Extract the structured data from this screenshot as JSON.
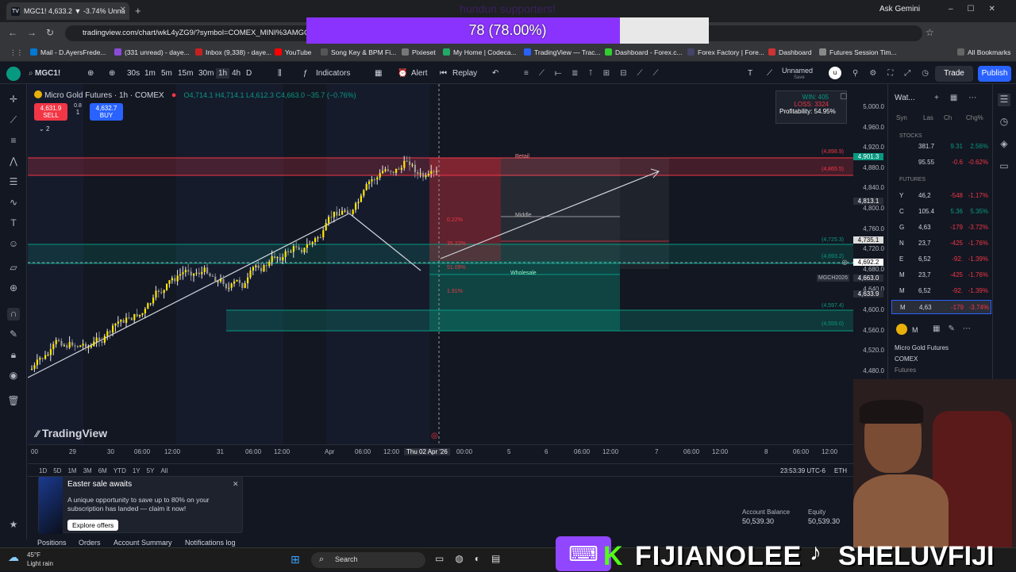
{
  "browser": {
    "tab_title": "MGC1! 4,633.2 ▼ -3.74% Unna",
    "ask_gemini": "Ask Gemini",
    "url": "tradingview.com/chart/wkL4yZG9/?symbol=COMEX_MINI%3AMGC1!",
    "bookmarks": [
      "Mail - D.AyersFrede...",
      "(331 unread) - daye...",
      "Inbox (9,338) - daye...",
      "YouTube",
      "Song Key & BPM Fi...",
      "Pixieset",
      "My Home | Codeca...",
      "TradingView — Trac...",
      "Dashboard - Forex.c...",
      "Forex Factory | Fore...",
      "Dashboard",
      "Futures Session Tim...",
      "All Bookmarks"
    ]
  },
  "poll": {
    "title": "hundun supporters!",
    "result": "78 (78.00%)",
    "percent": 78
  },
  "toolbar": {
    "symbol": "MGC1!",
    "intervals": [
      "30s",
      "1m",
      "5m",
      "15m",
      "30m",
      "1h",
      "4h",
      "D"
    ],
    "active_interval": "1h",
    "indicators": "Indicators",
    "alert": "Alert",
    "replay": "Replay",
    "layout_name": "Unnamed",
    "layout_sub": "Save",
    "trade": "Trade",
    "publish": "Publish"
  },
  "legend": {
    "title": "Micro Gold Futures · 1h · COMEX",
    "ohlc": "O4,714.1 H4,714.1 L4,612.3 C4,663.0 −35.7 (−0.76%)",
    "sell_price": "4,631.9",
    "sell_label": "SELL",
    "qty": "1",
    "qty_top": "0.8",
    "buy_price": "4,632.7",
    "buy_label": "BUY",
    "indicator_count": "2"
  },
  "stats": {
    "win": "WIN: 405",
    "loss": "LOSS: 3324",
    "profitability": "Profitability: 54.95%"
  },
  "chart_labels": {
    "retail": "Retail",
    "middle": "Middle",
    "wholesale": "Wholesale",
    "pct1": "0.22%",
    "pct2": "35.22%",
    "pct3": "51.09%",
    "pct4": "1.91%",
    "lvl1": "(4,898.9)",
    "lvl2": "(4,865.5)",
    "lvl3": "(4,725.3)",
    "lvl4": "(4,693.2)",
    "lvl5": "(4,597.4)",
    "lvl6": "(4,559.0)",
    "mgc_tag": "MGCH2026",
    "watermark": "TradingView"
  },
  "price_scale": [
    "5,000.0",
    "4,960.0",
    "4,920.0",
    "4,880.0",
    "4,840.0",
    "4,800.0",
    "4,760.0",
    "4,720.0",
    "4,680.0",
    "4,640.0",
    "4,600.0",
    "4,560.0",
    "4,520.0",
    "4,480.0"
  ],
  "price_tags": {
    "top": "4,901.3",
    "t2": "4,813.1",
    "t3": "4,735.1",
    "cur": "4,692.2",
    "c2": "4,663.0",
    "c3": "4,633.9"
  },
  "time_axis": [
    "00",
    "29",
    "30",
    "06:00",
    "12:00",
    "31",
    "06:00",
    "12:00",
    "Apr",
    "06:00",
    "12:00",
    "Thu 02 Apr '26",
    "00:00",
    "5",
    "6",
    "06:00",
    "12:00",
    "7",
    "06:00",
    "12:00",
    "8",
    "06:00",
    "12:00"
  ],
  "bottom_bar": {
    "ranges": [
      "1D",
      "5D",
      "1M",
      "3M",
      "6M",
      "YTD",
      "1Y",
      "5Y",
      "All"
    ],
    "clock": "23:53:39 UTC-6",
    "session": "ETH"
  },
  "watchlist": {
    "title": "Wat...",
    "cols": [
      "Syn",
      "Las",
      "Ch",
      "Chg%"
    ],
    "sections": [
      "STOCKS",
      "FUTURES"
    ],
    "rows": [
      {
        "sym": "",
        "last": "381.7",
        "chg": "9.31",
        "pct": "2.56%",
        "up": true
      },
      {
        "sym": "",
        "last": "95.55",
        "chg": "-0.6",
        "pct": "-0.62%",
        "up": false
      },
      {
        "sym": "Y",
        "last": "46,2",
        "chg": "-548",
        "pct": "-1.17%",
        "up": false
      },
      {
        "sym": "C",
        "last": "105.4",
        "chg": "5.36",
        "pct": "5.35%",
        "up": true
      },
      {
        "sym": "G",
        "last": "4,63",
        "chg": "-179",
        "pct": "-3.72%",
        "up": false
      },
      {
        "sym": "N",
        "last": "23,7",
        "chg": "-425",
        "pct": "-1.76%",
        "up": false
      },
      {
        "sym": "E",
        "last": "6,52",
        "chg": "-92.",
        "pct": "-1.39%",
        "up": false
      },
      {
        "sym": "M",
        "last": "23,7",
        "chg": "-425",
        "pct": "-1.76%",
        "up": false
      },
      {
        "sym": "M",
        "last": "6,52",
        "chg": "-92.",
        "pct": "-1.39%",
        "up": false
      },
      {
        "sym": "M",
        "last": "4,63",
        "chg": "-179",
        "pct": "-3.74%",
        "up": false
      }
    ],
    "detail_sym": "M",
    "detail_name": "Micro Gold Futures",
    "detail_exch": "COMEX",
    "detail_type": "Futures"
  },
  "panel": {
    "tabs": [
      "Positions",
      "Orders",
      "Account Summary",
      "Notifications log"
    ],
    "account_balance_label": "Account Balance",
    "account_balance": "50,539.30",
    "equity_label": "Equity",
    "equity": "50,539.30"
  },
  "toast": {
    "title": "Easter sale awaits",
    "body": "A unique opportunity to save up to 80% on your subscription has landed — claim it now!",
    "button": "Explore offers"
  },
  "taskbar": {
    "weather_temp": "45°F",
    "weather_desc": "Light rain",
    "search": "Search"
  },
  "stream_overlay": {
    "twitch": "FIJIANOLEE",
    "tiktok": "SHELUVFIJI"
  }
}
